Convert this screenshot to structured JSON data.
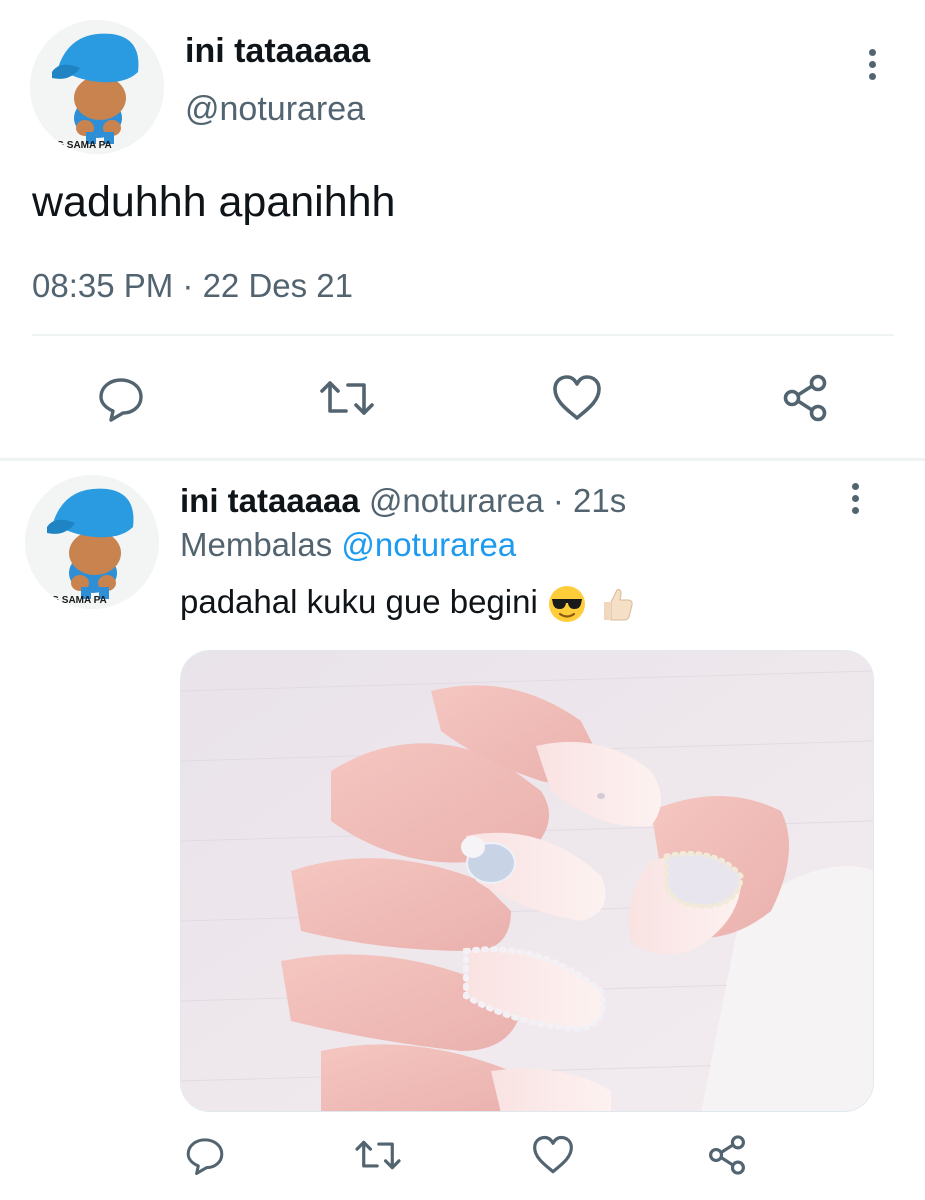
{
  "main_tweet": {
    "display_name": "ini tataaaaa",
    "handle": "@noturarea",
    "text": "waduhhh apanihhh",
    "timestamp": "08:35 PM · 22 Des 21",
    "avatar_caption": "NONG SAMA PA"
  },
  "reply_tweet": {
    "display_name": "ini tataaaaa",
    "handle": "@noturarea",
    "separator": " · ",
    "time_ago": "21s",
    "replying_prefix": "Membalas ",
    "replying_to": "@noturarea",
    "text": "padahal kuku gue begini",
    "emojis": [
      "sunglasses-emoji",
      "thumbs-up-emoji"
    ],
    "avatar_caption": "NONG SAMA PA",
    "media": "nail-art-photo"
  },
  "icons": [
    "reply-icon",
    "retweet-icon",
    "like-icon",
    "share-icon",
    "more-icon"
  ],
  "colors": {
    "text": "#0f1419",
    "secondary": "#536471",
    "link": "#1d9bf0",
    "divider": "#eff3f4"
  }
}
